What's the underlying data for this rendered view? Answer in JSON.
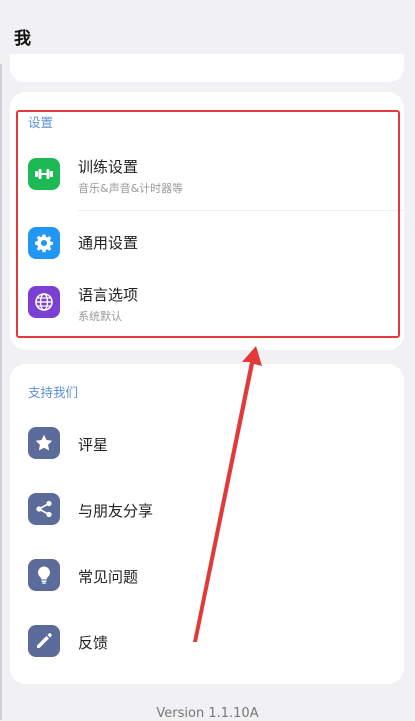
{
  "header": {
    "title": "我"
  },
  "settings": {
    "section_title": "设置",
    "items": [
      {
        "label": "训练设置",
        "sub": "音乐&声音&计时器等",
        "icon": "dumbbell-icon",
        "color": "#1db954"
      },
      {
        "label": "通用设置",
        "sub": "",
        "icon": "gear-icon",
        "color": "#2196f3"
      },
      {
        "label": "语言选项",
        "sub": "系统默认",
        "icon": "globe-icon",
        "color": "#7b3fd3"
      }
    ]
  },
  "support": {
    "section_title": "支持我们",
    "items": [
      {
        "label": "评星",
        "icon": "star-icon",
        "color": "#5b6b9a"
      },
      {
        "label": "与朋友分享",
        "icon": "share-icon",
        "color": "#5b6b9a"
      },
      {
        "label": "常见问题",
        "icon": "lightbulb-icon",
        "color": "#5b6b9a"
      },
      {
        "label": "反馈",
        "icon": "pencil-icon",
        "color": "#5b6b9a"
      }
    ]
  },
  "footer": {
    "version": "Version 1.1.10A"
  },
  "annotation": {
    "highlight_color": "#e23a3a"
  }
}
